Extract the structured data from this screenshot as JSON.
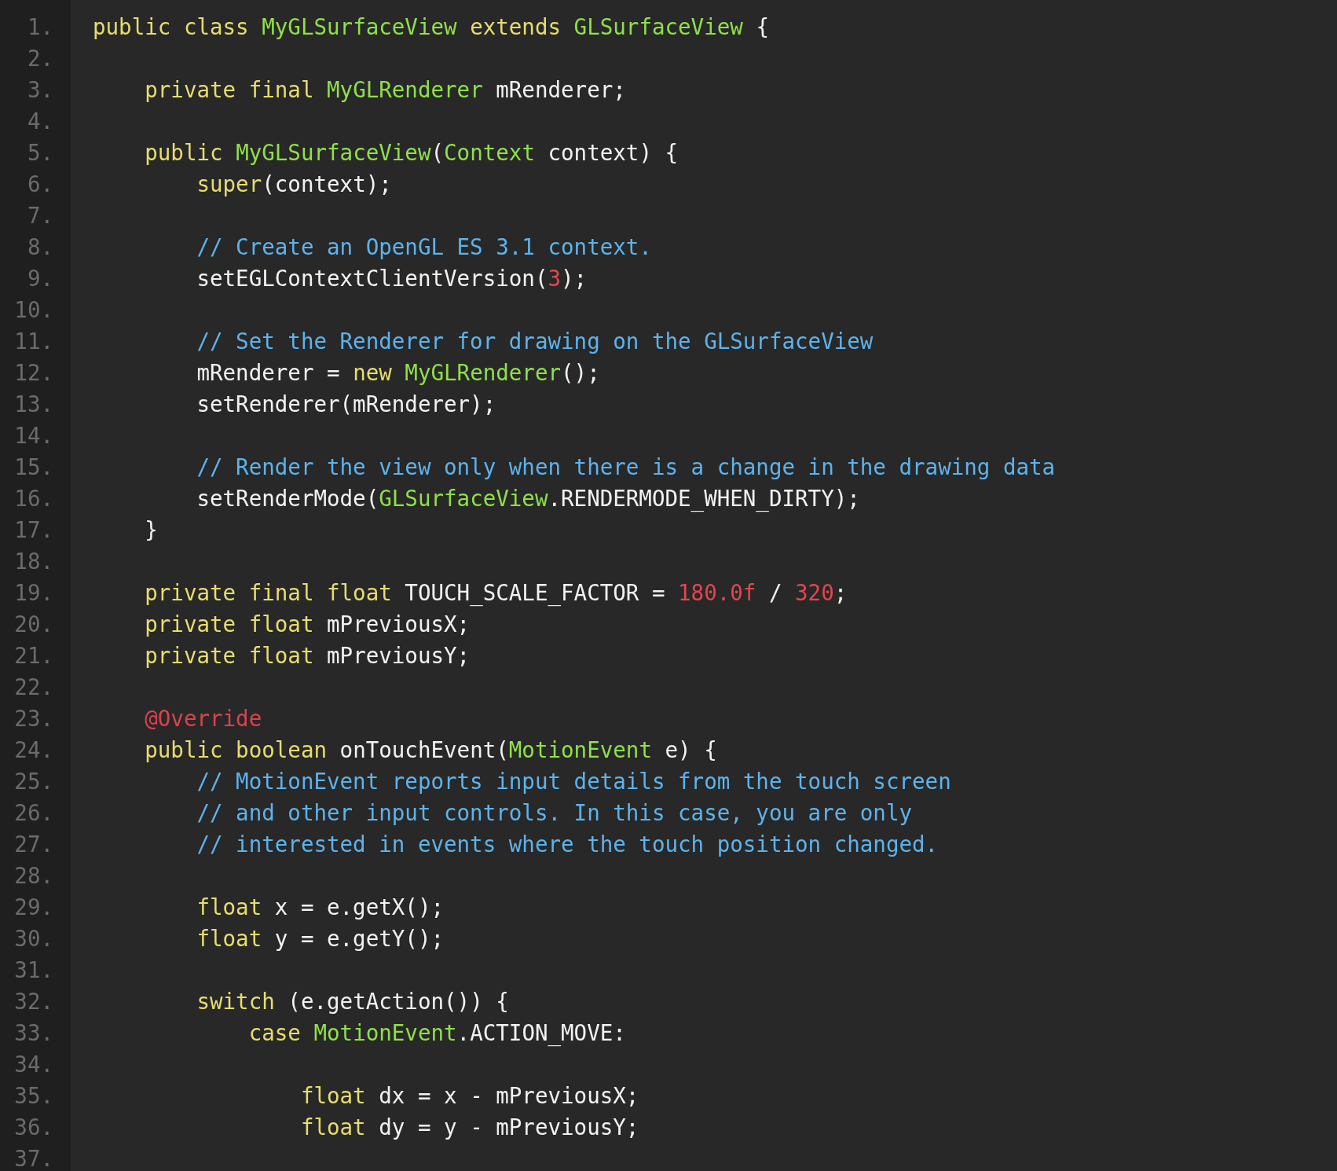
{
  "editor": {
    "lines": [
      {
        "number": "1.",
        "tokens": [
          {
            "kind": "keyword",
            "text": "public class "
          },
          {
            "kind": "type",
            "text": "MyGLSurfaceView "
          },
          {
            "kind": "keyword",
            "text": "extends "
          },
          {
            "kind": "type",
            "text": "GLSurfaceView "
          },
          {
            "kind": "plain",
            "text": "{"
          }
        ],
        "children": [
          {
            "number": "2."
          },
          {
            "number": "3.",
            "tokens": [
              {
                "kind": "keyword",
                "text": "private final "
              },
              {
                "kind": "type",
                "text": "MyGLRenderer "
              },
              {
                "kind": "plain",
                "text": "mRenderer;"
              }
            ]
          },
          {
            "number": "4."
          },
          {
            "number": "5.",
            "tokens": [
              {
                "kind": "keyword",
                "text": "public "
              },
              {
                "kind": "type",
                "text": "MyGLSurfaceView"
              },
              {
                "kind": "plain",
                "text": "("
              },
              {
                "kind": "type",
                "text": "Context "
              },
              {
                "kind": "plain",
                "text": "context) {"
              }
            ],
            "children": [
              {
                "number": "6.",
                "tokens": [
                  {
                    "kind": "keyword",
                    "text": "super"
                  },
                  {
                    "kind": "plain",
                    "text": "(context);"
                  }
                ]
              },
              {
                "number": "7."
              },
              {
                "number": "8.",
                "tokens": [
                  {
                    "kind": "comment",
                    "text": "// Create an OpenGL ES 3.1 context."
                  }
                ]
              },
              {
                "number": "9.",
                "tokens": [
                  {
                    "kind": "plain",
                    "text": "setEGLContextClientVersion("
                  },
                  {
                    "kind": "number",
                    "text": "3"
                  },
                  {
                    "kind": "plain",
                    "text": ");"
                  }
                ]
              },
              {
                "number": "10."
              },
              {
                "number": "11.",
                "tokens": [
                  {
                    "kind": "comment",
                    "text": "// Set the Renderer for drawing on the GLSurfaceView"
                  }
                ]
              },
              {
                "number": "12.",
                "tokens": [
                  {
                    "kind": "plain",
                    "text": "mRenderer = "
                  },
                  {
                    "kind": "keyword",
                    "text": "new "
                  },
                  {
                    "kind": "type",
                    "text": "MyGLRenderer"
                  },
                  {
                    "kind": "plain",
                    "text": "();"
                  }
                ]
              },
              {
                "number": "13.",
                "tokens": [
                  {
                    "kind": "plain",
                    "text": "setRenderer(mRenderer);"
                  }
                ]
              },
              {
                "number": "14."
              },
              {
                "number": "15.",
                "tokens": [
                  {
                    "kind": "comment",
                    "text": "// Render the view only when there is a change in the drawing data"
                  }
                ]
              },
              {
                "number": "16.",
                "tokens": [
                  {
                    "kind": "plain",
                    "text": "setRenderMode("
                  },
                  {
                    "kind": "type",
                    "text": "GLSurfaceView"
                  },
                  {
                    "kind": "plain",
                    "text": ".RENDERMODE_WHEN_DIRTY);"
                  }
                ]
              }
            ]
          },
          {
            "number": "17.",
            "tokens": [
              {
                "kind": "plain",
                "text": "}"
              }
            ]
          },
          {
            "number": "18."
          },
          {
            "number": "19.",
            "tokens": [
              {
                "kind": "keyword",
                "text": "private final float "
              },
              {
                "kind": "plain",
                "text": "TOUCH_SCALE_FACTOR = "
              },
              {
                "kind": "number",
                "text": "180.0f"
              },
              {
                "kind": "plain",
                "text": " / "
              },
              {
                "kind": "number",
                "text": "320"
              },
              {
                "kind": "plain",
                "text": ";"
              }
            ]
          },
          {
            "number": "20.",
            "tokens": [
              {
                "kind": "keyword",
                "text": "private float "
              },
              {
                "kind": "plain",
                "text": "mPreviousX;"
              }
            ]
          },
          {
            "number": "21.",
            "tokens": [
              {
                "kind": "keyword",
                "text": "private float "
              },
              {
                "kind": "plain",
                "text": "mPreviousY;"
              }
            ]
          },
          {
            "number": "22."
          },
          {
            "number": "23.",
            "tokens": [
              {
                "kind": "annotation",
                "text": "@Override"
              }
            ]
          },
          {
            "number": "24.",
            "tokens": [
              {
                "kind": "keyword",
                "text": "public boolean "
              },
              {
                "kind": "plain",
                "text": "onTouchEvent("
              },
              {
                "kind": "type",
                "text": "MotionEvent "
              },
              {
                "kind": "plain",
                "text": "e) {"
              }
            ],
            "children": [
              {
                "number": "25.",
                "tokens": [
                  {
                    "kind": "comment",
                    "text": "// MotionEvent reports input details from the touch screen"
                  }
                ]
              },
              {
                "number": "26.",
                "tokens": [
                  {
                    "kind": "comment",
                    "text": "// and other input controls. In this case, you are only"
                  }
                ]
              },
              {
                "number": "27.",
                "tokens": [
                  {
                    "kind": "comment",
                    "text": "// interested in events where the touch position changed."
                  }
                ]
              },
              {
                "number": "28."
              },
              {
                "number": "29.",
                "tokens": [
                  {
                    "kind": "keyword",
                    "text": "float "
                  },
                  {
                    "kind": "plain",
                    "text": "x = e.getX();"
                  }
                ]
              },
              {
                "number": "30.",
                "tokens": [
                  {
                    "kind": "keyword",
                    "text": "float "
                  },
                  {
                    "kind": "plain",
                    "text": "y = e.getY();"
                  }
                ]
              },
              {
                "number": "31."
              },
              {
                "number": "32.",
                "tokens": [
                  {
                    "kind": "keyword",
                    "text": "switch "
                  },
                  {
                    "kind": "plain",
                    "text": "(e.getAction()) {"
                  }
                ],
                "children": [
                  {
                    "number": "33.",
                    "tokens": [
                      {
                        "kind": "keyword",
                        "text": "case "
                      },
                      {
                        "kind": "type",
                        "text": "MotionEvent"
                      },
                      {
                        "kind": "plain",
                        "text": ".ACTION_MOVE:"
                      }
                    ],
                    "children": [
                      {
                        "number": "34."
                      },
                      {
                        "number": "35.",
                        "tokens": [
                          {
                            "kind": "keyword",
                            "text": "float "
                          },
                          {
                            "kind": "plain",
                            "text": "dx = x - mPreviousX;"
                          }
                        ]
                      },
                      {
                        "number": "36.",
                        "tokens": [
                          {
                            "kind": "keyword",
                            "text": "float "
                          },
                          {
                            "kind": "plain",
                            "text": "dy = y - mPreviousY;"
                          }
                        ]
                      },
                      {
                        "number": "37."
                      }
                    ]
                  }
                ]
              }
            ]
          }
        ]
      }
    ]
  }
}
